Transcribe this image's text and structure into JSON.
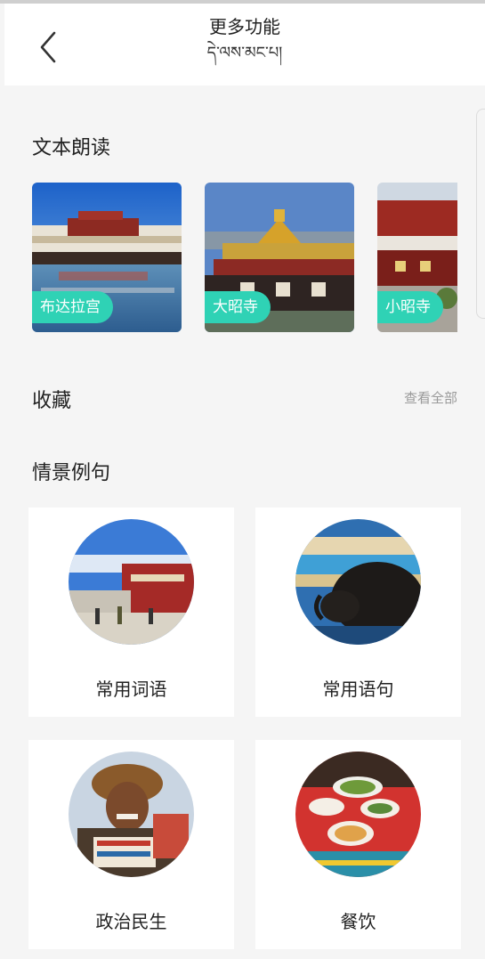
{
  "header": {
    "title": "更多功能",
    "subtitle": "དེ་ལས་མང་པ།",
    "back_icon": "chevron-left-icon"
  },
  "text_reading": {
    "title": "文本朗读",
    "items": [
      {
        "label": "布达拉宫"
      },
      {
        "label": "大昭寺"
      },
      {
        "label": "小昭寺"
      }
    ],
    "label_color": "#2fd2b5"
  },
  "favorites": {
    "title": "收藏",
    "see_all": "查看全部"
  },
  "scenes": {
    "title": "情景例句",
    "items": [
      {
        "label": "常用词语"
      },
      {
        "label": "常用语句"
      },
      {
        "label": "政治民生"
      },
      {
        "label": "餐饮"
      }
    ]
  }
}
